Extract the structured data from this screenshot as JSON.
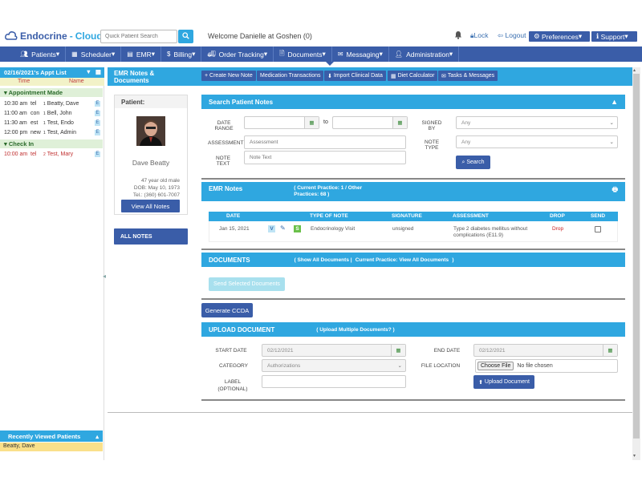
{
  "brand": {
    "part1": "Endocrine",
    "sep": "-",
    "part2": "Cloud"
  },
  "search": {
    "placeholder": "Quick Patient Search"
  },
  "welcome": "Welcome Danielle at Goshen (0)",
  "header": {
    "lock": "Lock",
    "logout": "Logout",
    "preferences": "Preferences",
    "support": "Support"
  },
  "nav": [
    {
      "label": "Patients",
      "icon": "users-icon"
    },
    {
      "label": "Scheduler",
      "icon": "calendar-icon"
    },
    {
      "label": "EMR",
      "icon": "folder-icon"
    },
    {
      "label": "Billing",
      "icon": "dollar-icon"
    },
    {
      "label": "Order Tracking",
      "icon": "truck-icon"
    },
    {
      "label": "Documents",
      "icon": "file-icon"
    },
    {
      "label": "Messaging",
      "icon": "envelope-icon"
    },
    {
      "label": "Administration",
      "icon": "user-icon"
    }
  ],
  "applist": {
    "title": "02/16/2021's Appt List",
    "col_time": "Time",
    "col_name": "Name",
    "section1": "Appointment Made",
    "rows1": [
      {
        "time": "10:30 am",
        "type": "tel",
        "sup": "1",
        "name": "Beatty, Dave"
      },
      {
        "time": "11:00 am",
        "type": "con",
        "sup": "1",
        "name": "Bell, John"
      },
      {
        "time": "11:30 am",
        "type": "est",
        "sup": "1",
        "name": "Test, Endo"
      },
      {
        "time": "12:00 pm",
        "type": "new",
        "sup": "1",
        "name": "Test, Admin"
      }
    ],
    "section2": "Check In",
    "rows2": [
      {
        "time": "10:00 am",
        "type": "tel",
        "sup": "2",
        "name": "Test, Mary"
      }
    ],
    "e_badge": "E"
  },
  "recent": {
    "title": "Recently Viewed Patients",
    "row": "Beatty, Dave"
  },
  "emr": {
    "title": "EMR Notes & Documents",
    "buttons": [
      "Create New Note",
      "Medication Transactions",
      "Import Clinical Data",
      "Diet Calculator",
      "Tasks & Messages"
    ]
  },
  "patient": {
    "header": "Patient:",
    "name": "Dave Beatty",
    "age": "47 year old male",
    "dob": "DOB: May 10, 1973",
    "tel": "Tel.: (360) 601-7007",
    "view_all": "View All Notes",
    "all_notes": "ALL NOTES"
  },
  "search_notes": {
    "title": "Search Patient Notes",
    "date_range": "DATE RANGE",
    "to": "to",
    "assessment_label": "ASSESSMENT",
    "assessment_ph": "Assessment",
    "note_text_label": "NOTE TEXT",
    "note_text_ph": "Note Text",
    "signed_by_label": "SIGNED BY",
    "signed_by_value": "Any",
    "note_type_label": "NOTE TYPE",
    "note_type_value": "Any",
    "search_btn": "Search"
  },
  "emr_notes": {
    "title": "EMR Notes",
    "sub": "( Current Practice: 1 / Other Practices: 68 )",
    "cols": [
      "DATE",
      "TYPE OF NOTE",
      "SIGNATURE",
      "ASSESSMENT",
      "DROP",
      "SEND"
    ],
    "row": {
      "date": "Jan 15, 2021",
      "badges": [
        "V",
        "S"
      ],
      "type": "Endocrinology Visit",
      "signature": "unsigned",
      "assessment": "Type 2 diabetes mellitus without complications (E11.9)",
      "drop": "Drop"
    }
  },
  "documents": {
    "title": "DOCUMENTS",
    "sub_all": "( Show All Documents |",
    "sub_cur": "Current Practice: View All Documents",
    "sub_end": ")",
    "send_btn": "Send Selected Documents",
    "ccda_btn": "Generate CCDA"
  },
  "upload": {
    "title": "UPLOAD DOCUMENT",
    "sub": "( Upload Multiple Documents? )",
    "start_label": "START DATE",
    "start_value": "02/12/2021",
    "end_label": "END DATE",
    "end_value": "02/12/2021",
    "category_label": "CATEGORY",
    "category_value": "Authorizations",
    "file_label": "FILE LOCATION",
    "choose": "Choose File",
    "nofile": "No file chosen",
    "label_label": "LABEL (OPTIONAL)",
    "upload_btn": "Upload Document"
  },
  "colors": {
    "primary": "#3a5da8",
    "accent": "#2fa7e0",
    "drop": "#cc2222",
    "check": "#2a6a2a"
  }
}
